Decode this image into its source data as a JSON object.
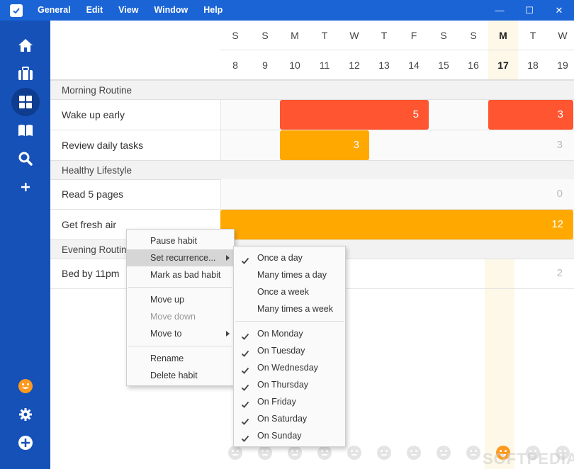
{
  "titlebar": {
    "menus": [
      "General",
      "Edit",
      "View",
      "Window",
      "Help"
    ],
    "controls": {
      "minimize": "—",
      "maximize": "☐",
      "close": "✕"
    }
  },
  "sidebar": {
    "top_icons": [
      "home-icon",
      "briefcase-icon",
      "grid-icon",
      "book-icon",
      "search-icon",
      "plus-icon"
    ],
    "active": "grid-icon",
    "bottom_icons": [
      "smiley-icon",
      "gear-icon",
      "add-circle-icon"
    ],
    "colors": {
      "background": "#1651b8",
      "active": "#0e3c8e",
      "smiley": "#ff9a1f"
    }
  },
  "calendar": {
    "days": [
      {
        "letter": "S",
        "num": "8"
      },
      {
        "letter": "S",
        "num": "9"
      },
      {
        "letter": "M",
        "num": "10"
      },
      {
        "letter": "T",
        "num": "11"
      },
      {
        "letter": "W",
        "num": "12"
      },
      {
        "letter": "T",
        "num": "13"
      },
      {
        "letter": "F",
        "num": "14"
      },
      {
        "letter": "S",
        "num": "15"
      },
      {
        "letter": "S",
        "num": "16"
      },
      {
        "letter": "M",
        "num": "17"
      },
      {
        "letter": "T",
        "num": "18"
      },
      {
        "letter": "W",
        "num": "19"
      }
    ],
    "today_index": 9
  },
  "groups": [
    {
      "name": "Morning Routine",
      "habits": [
        {
          "name": "Wake up early",
          "streaks": [
            {
              "start": 2,
              "end": 6,
              "value": "5",
              "color": "#ff5530"
            },
            {
              "start": 9,
              "end": 11,
              "value": "3",
              "color": "#ff5530"
            }
          ]
        },
        {
          "name": "Review daily tasks",
          "streaks": [
            {
              "start": 2,
              "end": 4,
              "value": "3",
              "color": "#ffa800"
            }
          ],
          "count": "3"
        }
      ]
    },
    {
      "name": "Healthy Lifestyle",
      "habits": [
        {
          "name": "Read 5 pages",
          "streaks": [],
          "count": "0"
        },
        {
          "name": "Get fresh air",
          "streaks": [
            {
              "start": 0,
              "end": 11,
              "value": "12",
              "color": "#ffa800"
            }
          ]
        }
      ]
    },
    {
      "name": "Evening Routine",
      "habits": [
        {
          "name": "Bed by 11pm",
          "streaks": [],
          "count": "2"
        }
      ]
    }
  ],
  "mood": {
    "active_index": 9
  },
  "watermark": "SOFTPEDIA®",
  "context_menu": {
    "items": [
      {
        "label": "Pause habit"
      },
      {
        "label": "Set recurrence...",
        "submenu": true,
        "hover": true
      },
      {
        "label": "Mark as bad habit"
      },
      {
        "label": "Move up"
      },
      {
        "label": "Move down",
        "disabled": true
      },
      {
        "label": "Move to",
        "submenu": true
      },
      {
        "label": "Rename"
      },
      {
        "label": "Delete habit"
      }
    ]
  },
  "recurrence_menu": {
    "frequency": [
      {
        "label": "Once a day",
        "checked": true
      },
      {
        "label": "Many times a day",
        "checked": false
      },
      {
        "label": "Once a week",
        "checked": false
      },
      {
        "label": "Many times a week",
        "checked": false
      }
    ],
    "weekdays": [
      {
        "label": "On Monday",
        "checked": true
      },
      {
        "label": "On Tuesday",
        "checked": true
      },
      {
        "label": "On Wednesday",
        "checked": true
      },
      {
        "label": "On Thursday",
        "checked": true
      },
      {
        "label": "On Friday",
        "checked": true
      },
      {
        "label": "On Saturday",
        "checked": true
      },
      {
        "label": "On Sunday",
        "checked": true
      }
    ]
  }
}
